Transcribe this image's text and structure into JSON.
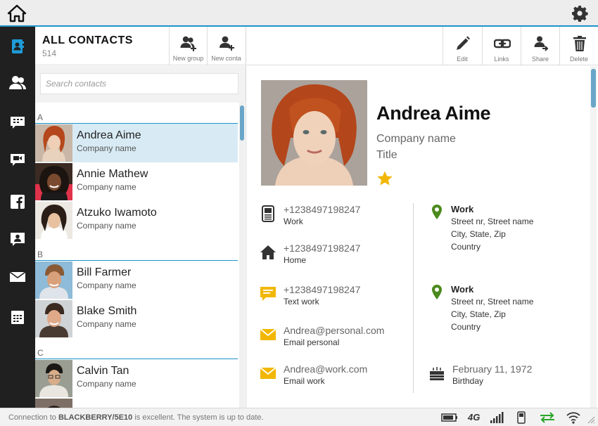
{
  "header": {
    "home_icon": "home-icon",
    "settings_icon": "gear-icon"
  },
  "rail": {
    "items": [
      {
        "icon": "contacts-book-icon",
        "active": true
      },
      {
        "icon": "groups-icon"
      },
      {
        "icon": "bbm-icon"
      },
      {
        "icon": "video-chat-icon"
      },
      {
        "icon": "facebook-icon"
      },
      {
        "icon": "profile-chat-icon"
      },
      {
        "icon": "email-icon"
      },
      {
        "icon": "calendar-icon"
      }
    ]
  },
  "list": {
    "title": "ALL CONTACTS",
    "count": "514",
    "new_group_label": "New group",
    "new_contact_label": "New conta",
    "search_placeholder": "Search contacts",
    "sections": [
      {
        "letter": "A",
        "contacts": [
          {
            "name": "Andrea Aime",
            "company": "Company name",
            "selected": true
          },
          {
            "name": "Annie Mathew",
            "company": "Company name"
          },
          {
            "name": "Atzuko Iwamoto",
            "company": "Company name"
          }
        ]
      },
      {
        "letter": "B",
        "contacts": [
          {
            "name": "Bill Farmer",
            "company": "Company name"
          },
          {
            "name": "Blake Smith",
            "company": "Company name"
          }
        ]
      },
      {
        "letter": "C",
        "contacts": [
          {
            "name": "Calvin Tan",
            "company": "Company name"
          }
        ]
      }
    ]
  },
  "toolbar": {
    "edit": "Edit",
    "links": "Links",
    "share": "Share",
    "delete": "Delete"
  },
  "detail": {
    "name": "Andrea Aime",
    "company": "Company name",
    "title": "Title",
    "favorite": true,
    "phones": [
      {
        "icon": "mobile-phone-icon",
        "value": "+1238497198247",
        "label": "Work"
      },
      {
        "icon": "home-phone-icon",
        "value": "+1238497198247",
        "label": "Home"
      },
      {
        "icon": "text-message-icon",
        "value": "+1238497198247",
        "label": "Text work"
      },
      {
        "icon": "envelope-icon",
        "value": "Andrea@personal.com",
        "label": "Email personal"
      },
      {
        "icon": "envelope-icon",
        "value": "Andrea@work.com",
        "label": "Email work"
      }
    ],
    "addresses": [
      {
        "label": "Work",
        "street": "Street nr, Street name",
        "city": "City, State, Zip",
        "country": "Country"
      },
      {
        "label": "Work",
        "street": "Street nr, Street name",
        "city": "City, State, Zip",
        "country": "Country"
      }
    ],
    "birthday": {
      "value": "February 11, 1972",
      "label": "Birthday"
    }
  },
  "status": {
    "prefix": "Connection to ",
    "device": "BLACKBERRY/5E10",
    "suffix": " is excellent. The system is up to date.",
    "network": "4G"
  },
  "colors": {
    "accent": "#1e93c9",
    "selected_row": "#d8ebf5",
    "yellow": "#f2b705",
    "green": "#4a8a1c",
    "rail": "#202020"
  }
}
